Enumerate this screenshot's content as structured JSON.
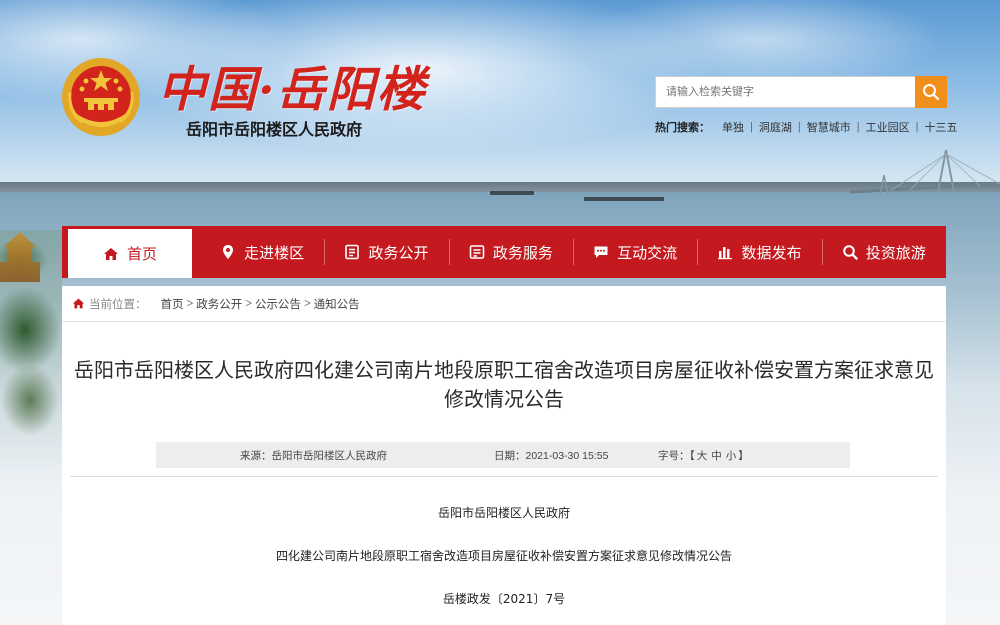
{
  "header": {
    "site_title": "中国·岳阳楼",
    "site_subtitle": "岳阳市岳阳楼区人民政府",
    "emblem": "national-emblem-icon"
  },
  "search": {
    "placeholder": "请输入检索关键字",
    "button_icon": "search-icon"
  },
  "hot_search": {
    "label": "热门搜索：",
    "items": [
      "单独",
      "洞庭湖",
      "智慧城市",
      "工业园区",
      "十三五"
    ]
  },
  "nav": {
    "items": [
      {
        "label": "首页",
        "icon": "home-icon"
      },
      {
        "label": "走进楼区",
        "icon": "location-pin-icon"
      },
      {
        "label": "政务公开",
        "icon": "document-icon"
      },
      {
        "label": "政务服务",
        "icon": "service-icon"
      },
      {
        "label": "互动交流",
        "icon": "chat-icon"
      },
      {
        "label": "数据发布",
        "icon": "bar-chart-icon"
      },
      {
        "label": "投资旅游",
        "icon": "search-zoom-icon"
      }
    ],
    "active_index": 0
  },
  "breadcrumb": {
    "label": "当前位置：",
    "items": [
      "首页",
      "政务公开",
      "公示公告",
      "通知公告"
    ],
    "separator": ">"
  },
  "article": {
    "title": "岳阳市岳阳楼区人民政府四化建公司南片地段原职工宿舍改造项目房屋征收补偿安置方案征求意见修改情况公告",
    "source": "来源：岳阳市岳阳楼区人民政府",
    "date": "日期：2021-03-30 15:55",
    "font_size_label": "字号：【",
    "font_size_options": [
      "大",
      "中",
      "小"
    ],
    "font_size_close": "】",
    "body": [
      "岳阳市岳阳楼区人民政府",
      "四化建公司南片地段原职工宿舍改造项目房屋征收补偿安置方案征求意见修改情况公告",
      "岳楼政发〔2021〕7号"
    ]
  },
  "colors": {
    "nav_red": "#c41a1f",
    "title_red": "#d2231c",
    "search_orange": "#f08f1c"
  }
}
